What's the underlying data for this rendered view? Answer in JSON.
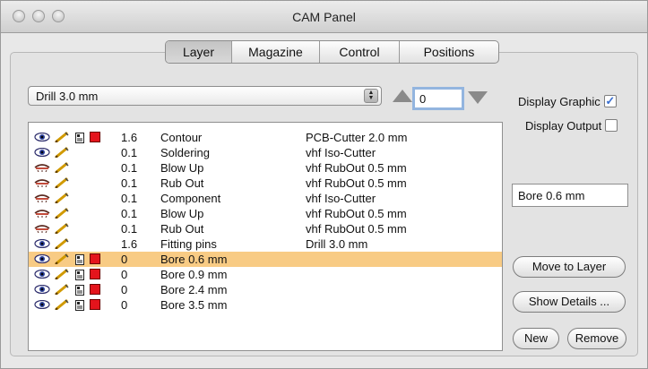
{
  "window": {
    "title": "CAM Panel"
  },
  "tabs": [
    {
      "label": "Layer",
      "active": true
    },
    {
      "label": "Magazine",
      "active": false
    },
    {
      "label": "Control",
      "active": false
    },
    {
      "label": "Positions",
      "active": false
    }
  ],
  "tool_select": {
    "value": "Drill 3.0 mm"
  },
  "stepper": {
    "value": "0"
  },
  "options": {
    "display_graphic": {
      "label": "Display Graphic",
      "checked": true
    },
    "display_output": {
      "label": "Display Output",
      "checked": false
    }
  },
  "layers": [
    {
      "visible": "open",
      "edit": true,
      "doc": true,
      "color": "#e4141c",
      "depth": "1.6",
      "name": "Contour",
      "tool": "PCB-Cutter 2.0 mm",
      "selected": false
    },
    {
      "visible": "open",
      "edit": true,
      "doc": false,
      "color": "",
      "depth": "0.1",
      "name": "Soldering",
      "tool": "vhf Iso-Cutter",
      "selected": false
    },
    {
      "visible": "closed",
      "edit": true,
      "doc": false,
      "color": "",
      "depth": "0.1",
      "name": "Blow Up",
      "tool": "vhf RubOut 0.5 mm",
      "selected": false
    },
    {
      "visible": "closed",
      "edit": true,
      "doc": false,
      "color": "",
      "depth": "0.1",
      "name": "Rub Out",
      "tool": "vhf RubOut 0.5 mm",
      "selected": false
    },
    {
      "visible": "closed",
      "edit": true,
      "doc": false,
      "color": "",
      "depth": "0.1",
      "name": "Component",
      "tool": "vhf Iso-Cutter",
      "selected": false
    },
    {
      "visible": "closed",
      "edit": true,
      "doc": false,
      "color": "",
      "depth": "0.1",
      "name": "Blow Up",
      "tool": "vhf RubOut 0.5 mm",
      "selected": false
    },
    {
      "visible": "closed",
      "edit": true,
      "doc": false,
      "color": "",
      "depth": "0.1",
      "name": "Rub Out",
      "tool": "vhf RubOut 0.5 mm",
      "selected": false
    },
    {
      "visible": "open",
      "edit": true,
      "doc": false,
      "color": "",
      "depth": "1.6",
      "name": "Fitting pins",
      "tool": "Drill 3.0 mm",
      "selected": false
    },
    {
      "visible": "open",
      "edit": true,
      "doc": true,
      "color": "#e4141c",
      "depth": "0",
      "name": "Bore 0.6 mm",
      "tool": "",
      "selected": true
    },
    {
      "visible": "open",
      "edit": true,
      "doc": true,
      "color": "#e4141c",
      "depth": "0",
      "name": "Bore 0.9 mm",
      "tool": "",
      "selected": false
    },
    {
      "visible": "open",
      "edit": true,
      "doc": true,
      "color": "#e4141c",
      "depth": "0",
      "name": "Bore 2.4 mm",
      "tool": "",
      "selected": false
    },
    {
      "visible": "open",
      "edit": true,
      "doc": true,
      "color": "#e4141c",
      "depth": "0",
      "name": "Bore 3.5 mm",
      "tool": "",
      "selected": false
    }
  ],
  "selected_layer_field": {
    "value": "Bore 0.6 mm"
  },
  "buttons": {
    "move_to_layer": "Move to Layer",
    "show_details": "Show Details ...",
    "new": "New",
    "remove": "Remove"
  },
  "colors": {
    "selection": "#f8cb84",
    "layer_marker": "#e4141c",
    "focus_ring": "#93b5df"
  }
}
